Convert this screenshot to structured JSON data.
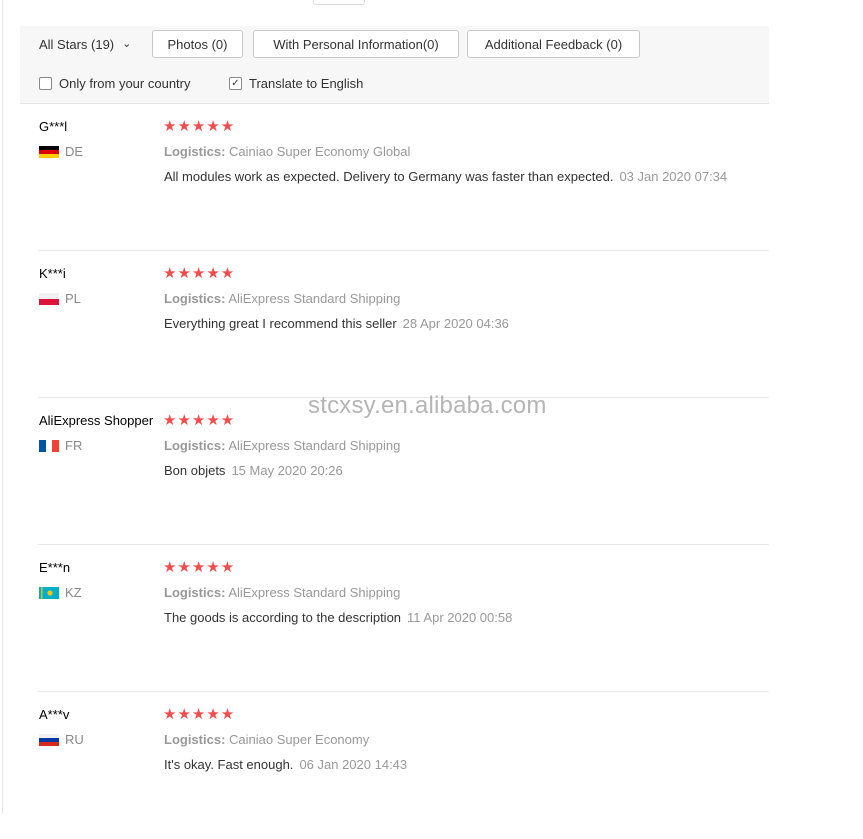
{
  "filters": {
    "star_select": "All Stars (19)",
    "buttons": [
      "Photos (0)",
      "With Personal Information(0)",
      "Additional Feedback (0)"
    ],
    "only_country": "Only from your country",
    "translate": "Translate to English",
    "translate_checked": true,
    "only_country_checked": false
  },
  "reviews": [
    {
      "user": "G***l",
      "country": "DE",
      "stars": "★★★★★",
      "rating": 5,
      "logistics_label": "Logistics:",
      "logistics": "Cainiao Super Economy Global",
      "text": "All modules work as expected. Delivery to Germany was faster than expected.",
      "date": "03 Jan 2020 07:34"
    },
    {
      "user": "K***i",
      "country": "PL",
      "stars": "★★★★★",
      "rating": 5,
      "logistics_label": "Logistics:",
      "logistics": "AliExpress Standard Shipping",
      "text": "Everything great I recommend this seller",
      "date": "28 Apr 2020 04:36"
    },
    {
      "user": "AliExpress Shopper",
      "country": "FR",
      "stars": "★★★★★",
      "rating": 5,
      "logistics_label": "Logistics:",
      "logistics": "AliExpress Standard Shipping",
      "text": "Bon objets",
      "date": "15 May 2020 20:26"
    },
    {
      "user": "E***n",
      "country": "KZ",
      "stars": "★★★★★",
      "rating": 5,
      "logistics_label": "Logistics:",
      "logistics": "AliExpress Standard Shipping",
      "text": "The goods is according to the description",
      "date": "11 Apr 2020 00:58"
    },
    {
      "user": "A***v",
      "country": "RU",
      "stars": "★★★★★",
      "rating": 5,
      "logistics_label": "Logistics:",
      "logistics": "Cainiao Super Economy",
      "text": "It's okay. Fast enough.",
      "date": "06 Jan 2020 14:43"
    }
  ],
  "watermark": "stcxsy.en.alibaba.com",
  "colors": {
    "star": "#f04d4d",
    "muted": "#999999",
    "bar_bg": "#f7f7f7"
  }
}
